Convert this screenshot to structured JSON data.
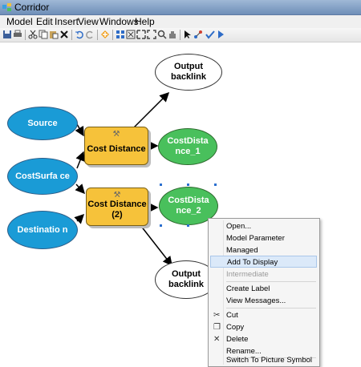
{
  "window": {
    "title": "Corridor"
  },
  "menu": [
    "Model",
    "Edit",
    "Insert",
    "View",
    "Windows",
    "Help"
  ],
  "nodes": {
    "source": "Source",
    "cost_surface": "CostSurfa ce",
    "destination": "Destinatio n",
    "cost_distance": "Cost Distance",
    "cost_distance_2": "Cost Distance (2)",
    "output_backlink_1": "Output backlink",
    "cost_distance_1_out": "CostDista nce_1",
    "cost_distance_2_out": "CostDista nce_2",
    "output_backlink_2": "Output backlink"
  },
  "context_menu": [
    {
      "label": "Open...",
      "enabled": true
    },
    {
      "label": "Model Parameter",
      "enabled": true
    },
    {
      "label": "Managed",
      "enabled": true
    },
    {
      "label": "Add To Display",
      "enabled": true,
      "highlighted": true
    },
    {
      "label": "Intermediate",
      "enabled": false
    },
    {
      "label": "Create Label",
      "enabled": true
    },
    {
      "label": "View Messages...",
      "enabled": true
    },
    {
      "label": "Cut",
      "enabled": true,
      "icon": "scissors-icon"
    },
    {
      "label": "Copy",
      "enabled": true,
      "icon": "copy-icon"
    },
    {
      "label": "Delete",
      "enabled": true,
      "icon": "delete-icon"
    },
    {
      "label": "Rename...",
      "enabled": true
    },
    {
      "label": "Switch To Picture Symbol",
      "enabled": true
    }
  ],
  "colors": {
    "data_input": "#1a9bd6",
    "tool": "#f6c23a",
    "derived_output": "#49c05c",
    "menu_highlight": "#dbe9f9"
  }
}
